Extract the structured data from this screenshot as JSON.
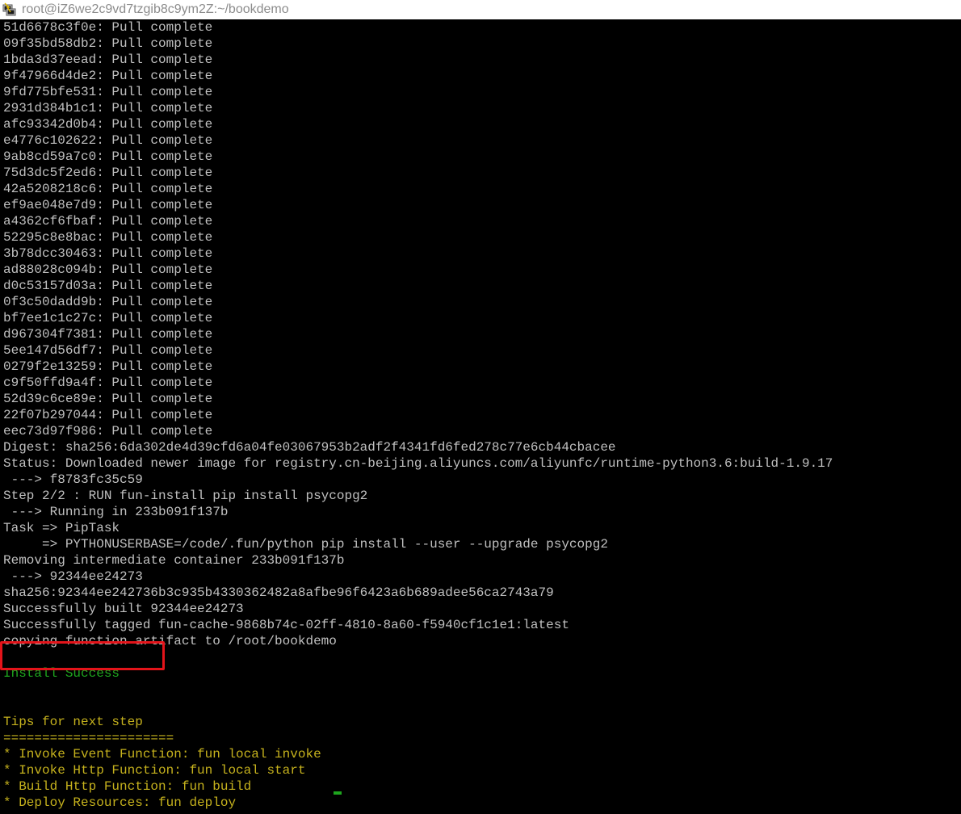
{
  "window": {
    "title": "root@iZ6we2c9vd7tzgib8c9ym2Z:~/bookdemo"
  },
  "terminal": {
    "lines": [
      {
        "text": "51d6678c3f0e: Pull complete",
        "color": "default"
      },
      {
        "text": "09f35bd58db2: Pull complete",
        "color": "default"
      },
      {
        "text": "1bda3d37eead: Pull complete",
        "color": "default"
      },
      {
        "text": "9f47966d4de2: Pull complete",
        "color": "default"
      },
      {
        "text": "9fd775bfe531: Pull complete",
        "color": "default"
      },
      {
        "text": "2931d384b1c1: Pull complete",
        "color": "default"
      },
      {
        "text": "afc93342d0b4: Pull complete",
        "color": "default"
      },
      {
        "text": "e4776c102622: Pull complete",
        "color": "default"
      },
      {
        "text": "9ab8cd59a7c0: Pull complete",
        "color": "default"
      },
      {
        "text": "75d3dc5f2ed6: Pull complete",
        "color": "default"
      },
      {
        "text": "42a5208218c6: Pull complete",
        "color": "default"
      },
      {
        "text": "ef9ae048e7d9: Pull complete",
        "color": "default"
      },
      {
        "text": "a4362cf6fbaf: Pull complete",
        "color": "default"
      },
      {
        "text": "52295c8e8bac: Pull complete",
        "color": "default"
      },
      {
        "text": "3b78dcc30463: Pull complete",
        "color": "default"
      },
      {
        "text": "ad88028c094b: Pull complete",
        "color": "default"
      },
      {
        "text": "d0c53157d03a: Pull complete",
        "color": "default"
      },
      {
        "text": "0f3c50dadd9b: Pull complete",
        "color": "default"
      },
      {
        "text": "bf7ee1c1c27c: Pull complete",
        "color": "default"
      },
      {
        "text": "d967304f7381: Pull complete",
        "color": "default"
      },
      {
        "text": "5ee147d56df7: Pull complete",
        "color": "default"
      },
      {
        "text": "0279f2e13259: Pull complete",
        "color": "default"
      },
      {
        "text": "c9f50ffd9a4f: Pull complete",
        "color": "default"
      },
      {
        "text": "52d39c6ce89e: Pull complete",
        "color": "default"
      },
      {
        "text": "22f07b297044: Pull complete",
        "color": "default"
      },
      {
        "text": "eec73d97f986: Pull complete",
        "color": "default"
      },
      {
        "text": "Digest: sha256:6da302de4d39cfd6a04fe03067953b2adf2f4341fd6fed278c77e6cb44cbacee",
        "color": "default"
      },
      {
        "text": "Status: Downloaded newer image for registry.cn-beijing.aliyuncs.com/aliyunfc/runtime-python3.6:build-1.9.17",
        "color": "default"
      },
      {
        "text": " ---> f8783fc35c59",
        "color": "default"
      },
      {
        "text": "Step 2/2 : RUN fun-install pip install psycopg2",
        "color": "default"
      },
      {
        "text": " ---> Running in 233b091f137b",
        "color": "default"
      },
      {
        "text": "Task => PipTask",
        "color": "default"
      },
      {
        "text": "     => PYTHONUSERBASE=/code/.fun/python pip install --user --upgrade psycopg2",
        "color": "default"
      },
      {
        "text": "Removing intermediate container 233b091f137b",
        "color": "default"
      },
      {
        "text": " ---> 92344ee24273",
        "color": "default"
      },
      {
        "text": "sha256:92344ee242736b3c935b4330362482a8afbe96f6423a6b689adee56ca2743a79",
        "color": "default"
      },
      {
        "text": "Successfully built 92344ee24273",
        "color": "default"
      },
      {
        "text": "Successfully tagged fun-cache-9868b74c-02ff-4810-8a60-f5940cf1c1e1:latest",
        "color": "default"
      },
      {
        "text": "copying function artifact to /root/bookdemo",
        "color": "default"
      },
      {
        "text": "",
        "color": "default"
      },
      {
        "text": "Install Success",
        "color": "green"
      },
      {
        "text": "",
        "color": "default"
      },
      {
        "text": "",
        "color": "default"
      },
      {
        "text": "Tips for next step",
        "color": "yellow"
      },
      {
        "text": "======================",
        "color": "yellow"
      },
      {
        "text": "* Invoke Event Function: fun local invoke",
        "color": "yellow"
      },
      {
        "text": "* Invoke Http Function: fun local start",
        "color": "yellow"
      },
      {
        "text": "* Build Http Function: fun build",
        "color": "yellow"
      },
      {
        "text": "* Deploy Resources: fun deploy",
        "color": "yellow"
      }
    ]
  },
  "colors": {
    "background": "#000000",
    "default_text": "#c0c0c0",
    "success_text": "#1ea51e",
    "tips_text": "#c6b21d",
    "highlight_border": "#e3141a"
  },
  "icons": {
    "app_icon": "putty-terminal-icon"
  }
}
